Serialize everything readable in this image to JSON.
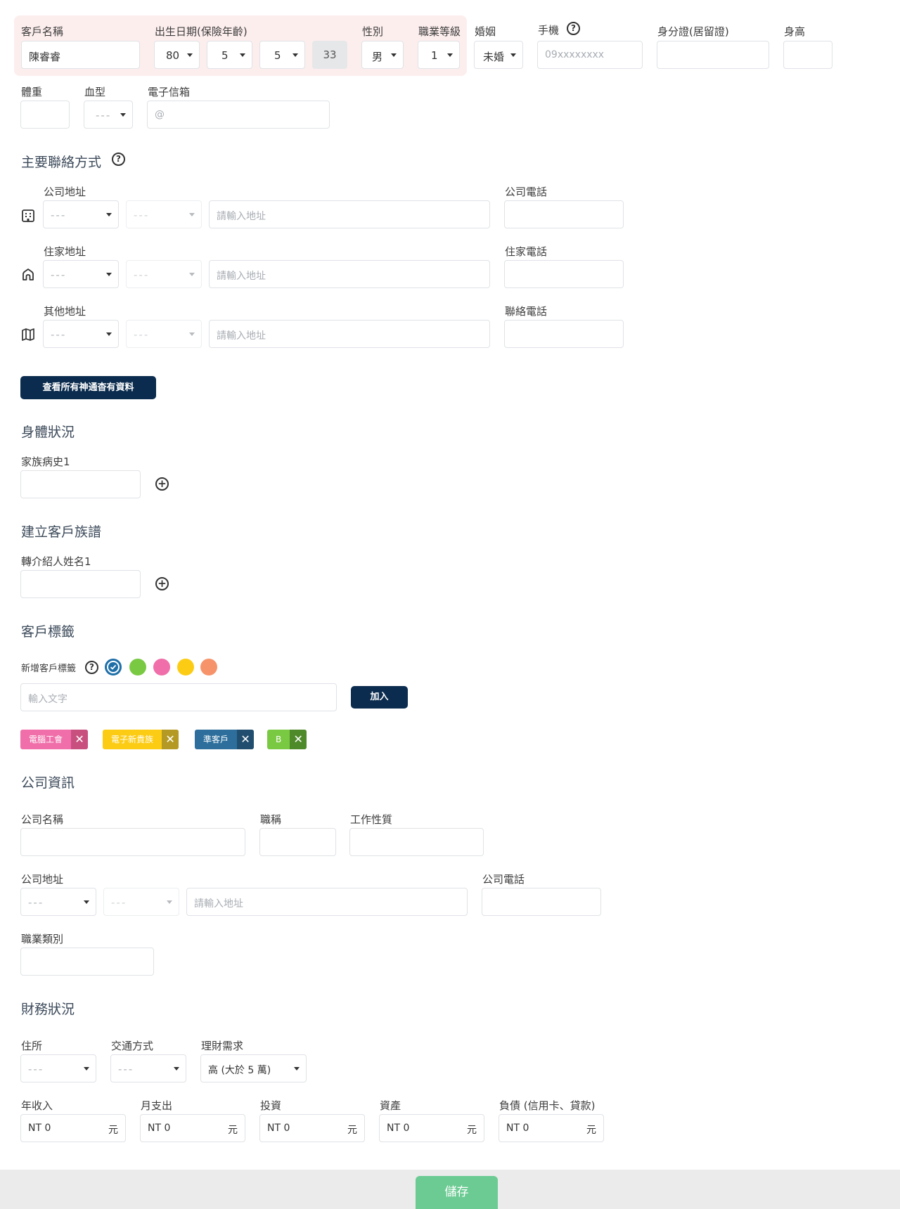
{
  "basic": {
    "name_label": "客戶名稱",
    "name_value": "陳睿睿",
    "birth_label": "出生日期(保險年齡)",
    "birth_year": "80",
    "birth_month": "5",
    "birth_day": "5",
    "age": "33",
    "gender_label": "性別",
    "gender_value": "男",
    "job_level_label": "職業等級",
    "job_level_value": "1",
    "marriage_label": "婚姻",
    "marriage_value": "未婚",
    "mobile_label": "手機",
    "mobile_placeholder": "09xxxxxxxx",
    "id_label": "身分證(居留證)",
    "height_label": "身高",
    "weight_label": "體重",
    "blood_label": "血型",
    "blood_value": "---",
    "email_label": "電子信箱",
    "email_placeholder": "@"
  },
  "contact": {
    "title": "主要聯絡方式",
    "addr_placeholder": "請輸入地址",
    "dash": "---",
    "rows": [
      {
        "addr_label": "公司地址",
        "phone_label": "公司電話"
      },
      {
        "addr_label": "住家地址",
        "phone_label": "住家電話"
      },
      {
        "addr_label": "其他地址",
        "phone_label": "聯絡電話"
      }
    ],
    "view_button": "查看所有神通杳有資料"
  },
  "health": {
    "title": "身體狀況",
    "history_label": "家族病史1"
  },
  "family": {
    "title": "建立客戶族譜",
    "referrer_label": "轉介紹人姓名1"
  },
  "tags": {
    "title": "客戶標籤",
    "add_label": "新增客戶標籤",
    "input_placeholder": "輸入文字",
    "add_button": "加入",
    "colors": [
      "#1e6fa8",
      "#7ac943",
      "#f06ea9",
      "#fccc15",
      "#f7936a"
    ],
    "items": [
      {
        "text": "電腦工會",
        "color": "#f06ea9",
        "xcolor": "#c8507f"
      },
      {
        "text": "電子新貴族",
        "color": "#fccc15",
        "xcolor": "#b49a24"
      },
      {
        "text": "準客戶",
        "color": "#2d6e9c",
        "xcolor": "#214e6e"
      },
      {
        "text": "B",
        "color": "#7ac943",
        "xcolor": "#4f8a2a"
      }
    ]
  },
  "company": {
    "title": "公司資訊",
    "name_label": "公司名稱",
    "position_label": "職稱",
    "nature_label": "工作性質",
    "addr_label": "公司地址",
    "phone_label": "公司電話",
    "addr_placeholder": "請輸入地址",
    "dash": "---",
    "category_label": "職業類別"
  },
  "finance": {
    "title": "財務狀況",
    "residence_label": "住所",
    "residence_value": "---",
    "transport_label": "交通方式",
    "transport_value": "---",
    "need_label": "理財需求",
    "need_value": "高 (大於 5 萬)",
    "prefix": "NT 0",
    "suffix": "元",
    "fields": [
      {
        "label": "年收入"
      },
      {
        "label": "月支出"
      },
      {
        "label": "投資"
      },
      {
        "label": "資產"
      },
      {
        "label": "負債 (信用卡、貸款)"
      }
    ]
  },
  "footer": {
    "save_button": "儲存"
  }
}
